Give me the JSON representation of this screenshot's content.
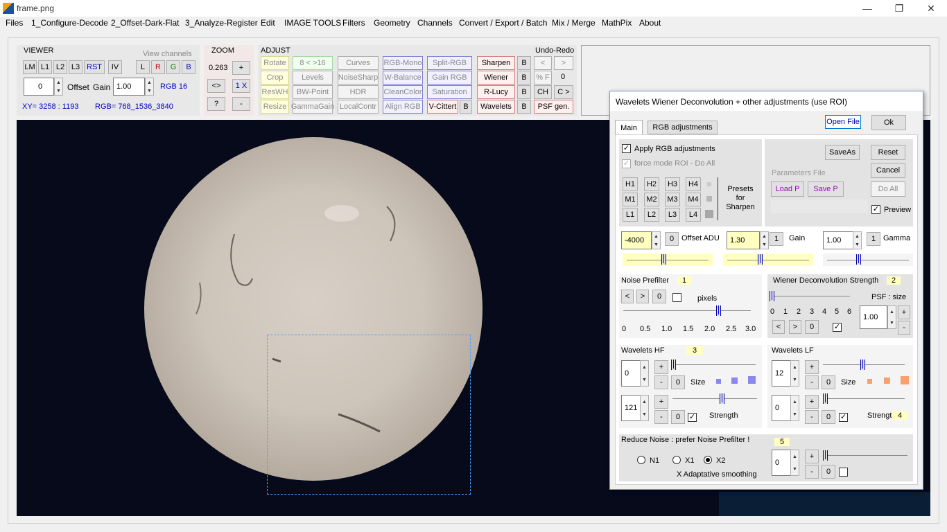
{
  "window": {
    "title": "frame.png",
    "minimize": "—",
    "maximize": "❐",
    "close": "✕"
  },
  "menu": [
    "Files",
    "1_Configure-Decode",
    "2_Offset-Dark-Flat",
    "3_Analyze-Register",
    "Edit",
    "IMAGE TOOLS",
    "Filters",
    "Geometry",
    "Channels",
    "Convert / Export / Batch",
    "Mix / Merge",
    "MathPix",
    "About"
  ],
  "viewer": {
    "title": "VIEWER",
    "view_channels": "View channels",
    "lm": "LM",
    "l1": "L1",
    "l2": "L2",
    "l3": "L3",
    "rst": "RST",
    "iv": "IV",
    "ch_l": "L",
    "ch_r": "R",
    "ch_g": "G",
    "ch_b": "B",
    "offset_value": "0",
    "offset_label": "Offset",
    "gain_label": "Gain",
    "gain_value": "1.00",
    "bitdepth": "RGB 16",
    "xy": "XY=  3258 : 1193",
    "rgb": "RGB=   768_1536_3840"
  },
  "zoom": {
    "title": "ZOOM",
    "value": "0.263",
    "plus": "+",
    "fit": "<>",
    "onex": "1 X",
    "help": "?",
    "minus": "-"
  },
  "adjust": {
    "title": "ADJUST",
    "undo_redo": "Undo-Redo",
    "buttons": {
      "rotate": "Rotate",
      "bits": "8 < >16",
      "curves": "Curves",
      "rgbmono": "RGB-Mono",
      "splitrgb": "Split-RGB",
      "sharpen": "Sharpen",
      "b1": "B",
      "undo": "<",
      "redo": ">",
      "crop": "Crop",
      "levels": "Levels",
      "noisesharp": "NoiseSharp",
      "wbalance": "W-Balance",
      "gainrgb": "Gain RGB",
      "wiener": "Wiener",
      "b2": "B",
      "pctf": "% F",
      "count": "0",
      "reswh": "ResWH",
      "bwpoint": "BW-Point",
      "hdr": "HDR",
      "cleancolor": "CleanColor",
      "saturation": "Saturation",
      "rlucy": "R-Lucy",
      "b3": "B",
      "ch": "CH",
      "cgt": "C >",
      "resize": "Resize",
      "gammagain": "GammaGain",
      "localcontr": "LocalContr",
      "alignrgb": "Align RGB",
      "vcittert": "V-Cittert",
      "b4": "B",
      "wavelets": "Wavelets",
      "b5": "B",
      "psfgen": "PSF gen."
    }
  },
  "dialog": {
    "title": "Wavelets Wiener Deconvolution + other adjustments    (use ROI)",
    "tabs": {
      "main": "Main",
      "rgb": "RGB adjustments"
    },
    "open_file": "Open File",
    "ok": "Ok",
    "save_as": "SaveAs",
    "reset": "Reset",
    "cancel": "Cancel",
    "do_all": "Do All",
    "apply_rgb": "Apply RGB adjustments",
    "force_mode": "force mode  ROI - Do All",
    "params_file": "Parameters File",
    "load_p": "Load P",
    "save_p": "Save P",
    "preview": "Preview",
    "presets": {
      "row1": [
        "H1",
        "H2",
        "H3",
        "H4"
      ],
      "row2": [
        "M1",
        "M2",
        "M3",
        "M4"
      ],
      "row3": [
        "L1",
        "L2",
        "L3",
        "L4"
      ],
      "label": "Presets\nfor\nSharpen"
    },
    "offset": {
      "value": "-4000",
      "zero": "0",
      "label": "Offset ADU",
      "level": 0.45
    },
    "gain": {
      "value": "1.30",
      "one": "1",
      "label": "Gain",
      "level": 0.4
    },
    "gamma": {
      "value": "1.00",
      "one": "1",
      "label": "Gamma",
      "level": 0.38
    },
    "noise": {
      "title": "Noise Prefilter",
      "badge": "1",
      "prev": "<",
      "next": ">",
      "zero": "0",
      "pixels": "pixels",
      "ticks": [
        "0",
        "0.5",
        "1.0",
        "1.5",
        "2.0",
        "2.5",
        "3.0"
      ],
      "level": 2.3
    },
    "wiener": {
      "title": "Wiener Deconvolution Strength",
      "badge": "2",
      "ticks": [
        "0",
        "1",
        "2",
        "3",
        "4",
        "5",
        "6"
      ],
      "prev": "<",
      "next": ">",
      "zero": "0",
      "psf_label": "PSF : size",
      "psf_value": "1.00",
      "plus": "+",
      "minus": "-",
      "level": 0
    },
    "hf": {
      "title": "Wavelets HF",
      "badge": "3",
      "size_value": "0",
      "strength_value": "121",
      "plus": "+",
      "minus": "-",
      "zero": "0",
      "size_label": "Size",
      "strength_label": "Strength"
    },
    "lf": {
      "title": "Wavelets LF",
      "badge": "4",
      "size_value": "12",
      "strength_value": "0",
      "plus": "+",
      "minus": "-",
      "zero": "0",
      "size_label": "Size",
      "strength_label": "Strength"
    },
    "reduce": {
      "title": "Reduce Noise :  prefer Noise Prefilter !",
      "badge": "5",
      "n1": "N1",
      "x1": "X1",
      "x2": "X2",
      "adaptive": "X Adaptative smoothing",
      "value": "0",
      "plus": "+",
      "minus": "-",
      "zero": "0"
    }
  },
  "colors": {
    "accent_blue": "#0000c0",
    "red": "#d00000",
    "green": "#008000",
    "purple": "#a000c0",
    "yellow": "#ffffc0"
  }
}
